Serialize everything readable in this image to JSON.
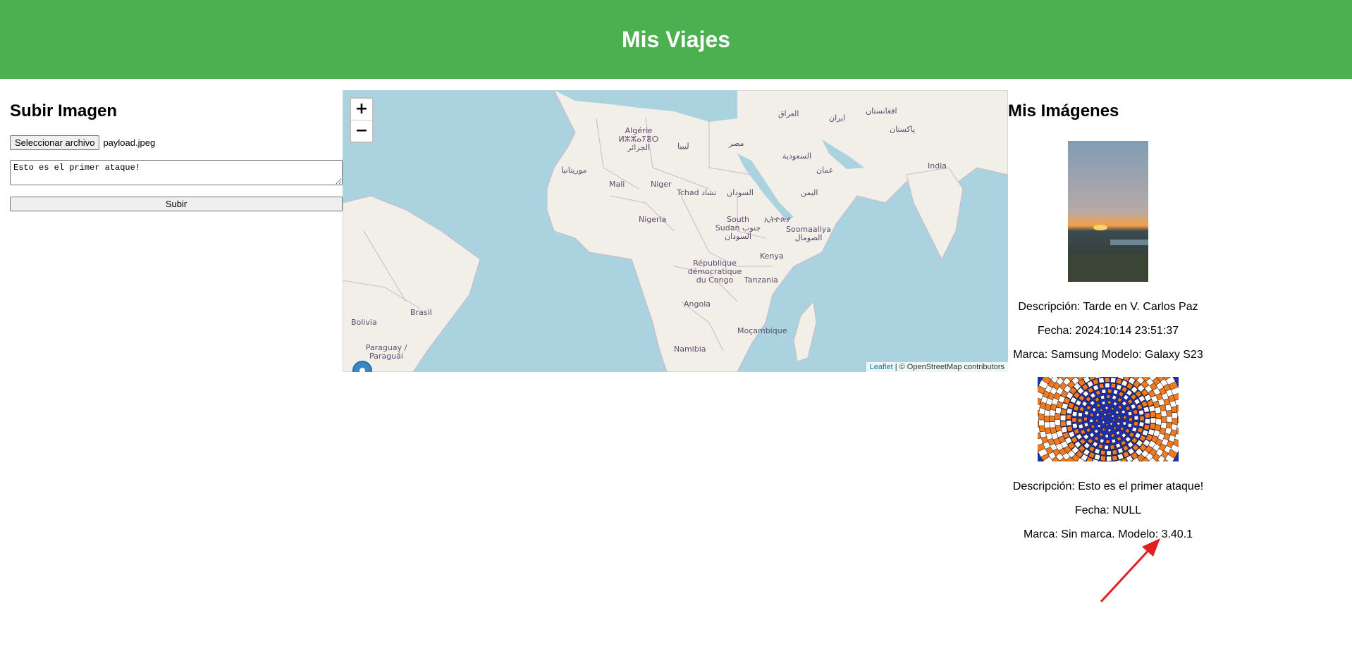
{
  "header": {
    "title": "Mis Viajes"
  },
  "upload": {
    "title": "Subir Imagen",
    "file_button_label": "Seleccionar archivo",
    "file_name": "payload.jpeg",
    "description_value": "Esto es el primer ataque!",
    "submit_label": "Subir"
  },
  "map": {
    "zoom_in": "+",
    "zoom_out": "−",
    "attribution_link": "Leaflet",
    "attribution_text": " | © OpenStreetMap contributors",
    "labels": [
      "Algérie ⵍⵣⵣⴰⵢⴻⵔ الجزائر",
      "ليبيا",
      "مصر",
      "العراق",
      "ایران",
      "افغانستان",
      "پاکستان",
      "India",
      "السعودية",
      "عمان",
      "اليمن",
      "موريتانيا",
      "Mali",
      "Niger",
      "Tchad تشاد",
      "السودان",
      "Nigeria",
      "South Sudan جنوب السودان",
      "ኢትዮጵያ",
      "Soomaaliya الصومال",
      "Kenya",
      "République démocratique du Congo",
      "Tanzania",
      "Angola",
      "Moçambique",
      "Namibia",
      "Brasil",
      "Bolivia",
      "Paraguay / Paraguái"
    ]
  },
  "gallery": {
    "title": "Mis Imágenes",
    "items": [
      {
        "description": "Descripción: Tarde en V. Carlos Paz",
        "date": "Fecha: 2024:10:14 23:51:37",
        "device": "Marca: Samsung Modelo: Galaxy S23"
      },
      {
        "description": "Descripción: Esto es el primer ataque!",
        "date": "Fecha: NULL",
        "device": "Marca: Sin marca. Modelo: 3.40.1"
      }
    ]
  },
  "colors": {
    "header_bg": "#4caf50",
    "sea": "#aad3df",
    "land": "#f2efe9",
    "arrow": "#e02020"
  }
}
